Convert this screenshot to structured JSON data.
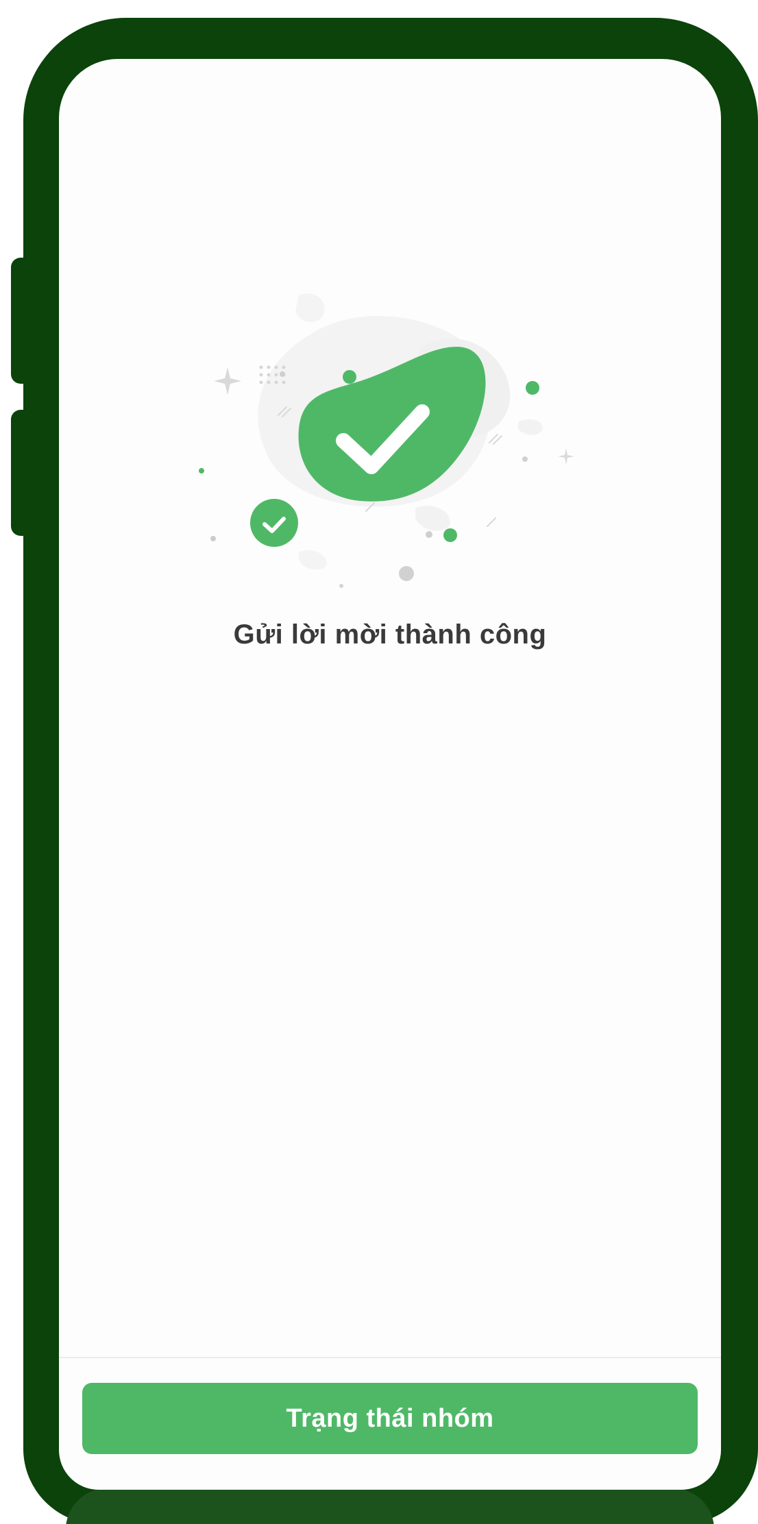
{
  "colors": {
    "frame": "#0b430b",
    "accent": "#4fb867",
    "text": "#3a3a3a",
    "screen_background": "#fdfdfd"
  },
  "illustration": {
    "icon": "success-checkmark-icon"
  },
  "message": {
    "text": "Gửi lời mời thành công"
  },
  "footer": {
    "button_label": "Trạng thái nhóm"
  }
}
